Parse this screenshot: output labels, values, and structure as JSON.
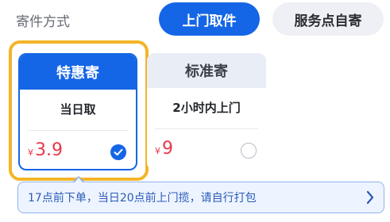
{
  "header": {
    "method_label": "寄件方式",
    "option_pickup": "上门取件",
    "option_dropoff": "服务点自寄"
  },
  "cards": [
    {
      "title": "特惠寄",
      "subtitle": "当日取",
      "currency": "¥",
      "price": "3.9",
      "selected": true
    },
    {
      "title": "标准寄",
      "subtitle": "2小时内上门",
      "currency": "¥",
      "price": "9",
      "selected": false
    }
  ],
  "banner": {
    "text": "17点前下单，当日20点前上门揽，请自行打包"
  },
  "colors": {
    "accent": "#1466e6",
    "price": "#e8384a",
    "highlight": "#f3b428"
  },
  "icons": {
    "selected_radio": "check-circle-icon",
    "unselected_radio": "radio-empty-icon",
    "banner_arrow": "chevron-right-icon"
  }
}
